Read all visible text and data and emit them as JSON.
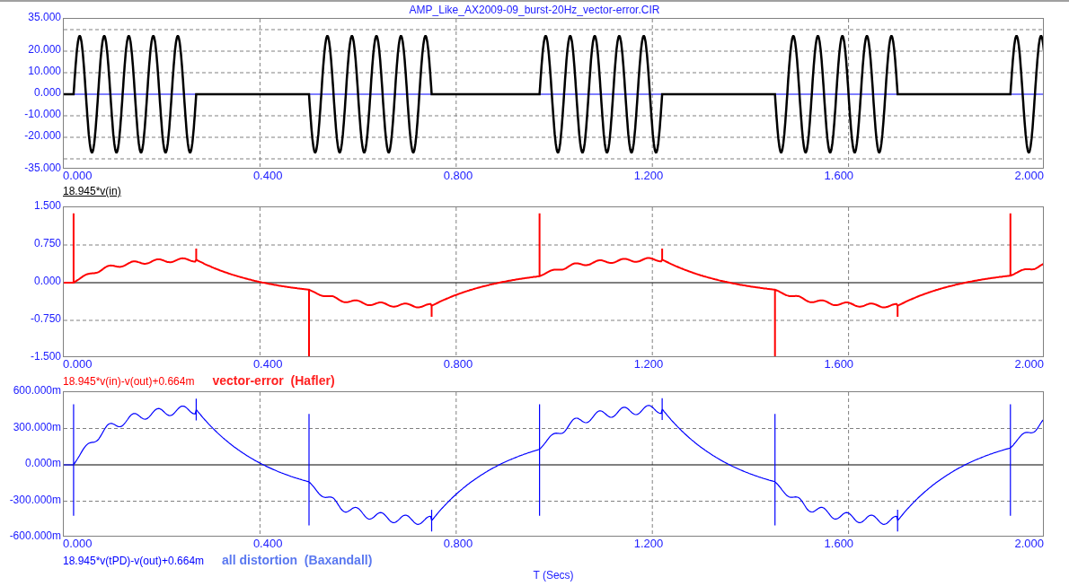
{
  "title": "AMP_Like_AX2009-09_burst-20Hz_vector-error.CIR",
  "panels": [
    {
      "kind": "burst",
      "color": "#000000",
      "y_ticks": [
        "35.000",
        "20.000",
        "10.000",
        "0.000",
        "-10.000",
        "-20.000",
        "-35.000"
      ],
      "x_ticks": [
        "0.000",
        "0.400",
        "0.800",
        "1.200",
        "1.600",
        "2.000"
      ],
      "trace_label": "18.945*v(in)",
      "selected": true
    },
    {
      "kind": "error",
      "color": "#ff0000",
      "y_ticks": [
        "1.500",
        "0.750",
        "0.000",
        "-0.750",
        "-1.500"
      ],
      "x_ticks": [
        "0.000",
        "0.400",
        "0.800",
        "1.200",
        "1.600",
        "2.000"
      ],
      "trace_label": "18.945*v(in)-v(out)+0.664m",
      "selected": false,
      "caption": {
        "text": "vector-error  (Hafler)",
        "color": "#ff2020"
      }
    },
    {
      "kind": "distortion",
      "color": "#0000ff",
      "y_ticks": [
        "600.000m",
        "300.000m",
        "0.000m",
        "-300.000m",
        "-600.000m"
      ],
      "x_ticks": [
        "0.000",
        "0.400",
        "0.800",
        "1.200",
        "1.600",
        "2.000"
      ],
      "trace_label": "18.945*v(tPD)-v(out)+0.664m",
      "selected": false,
      "caption": {
        "text": "all distortion  (Baxandall)",
        "color": "#5a78f0"
      }
    }
  ],
  "x_axis_title": "T (Secs)"
}
